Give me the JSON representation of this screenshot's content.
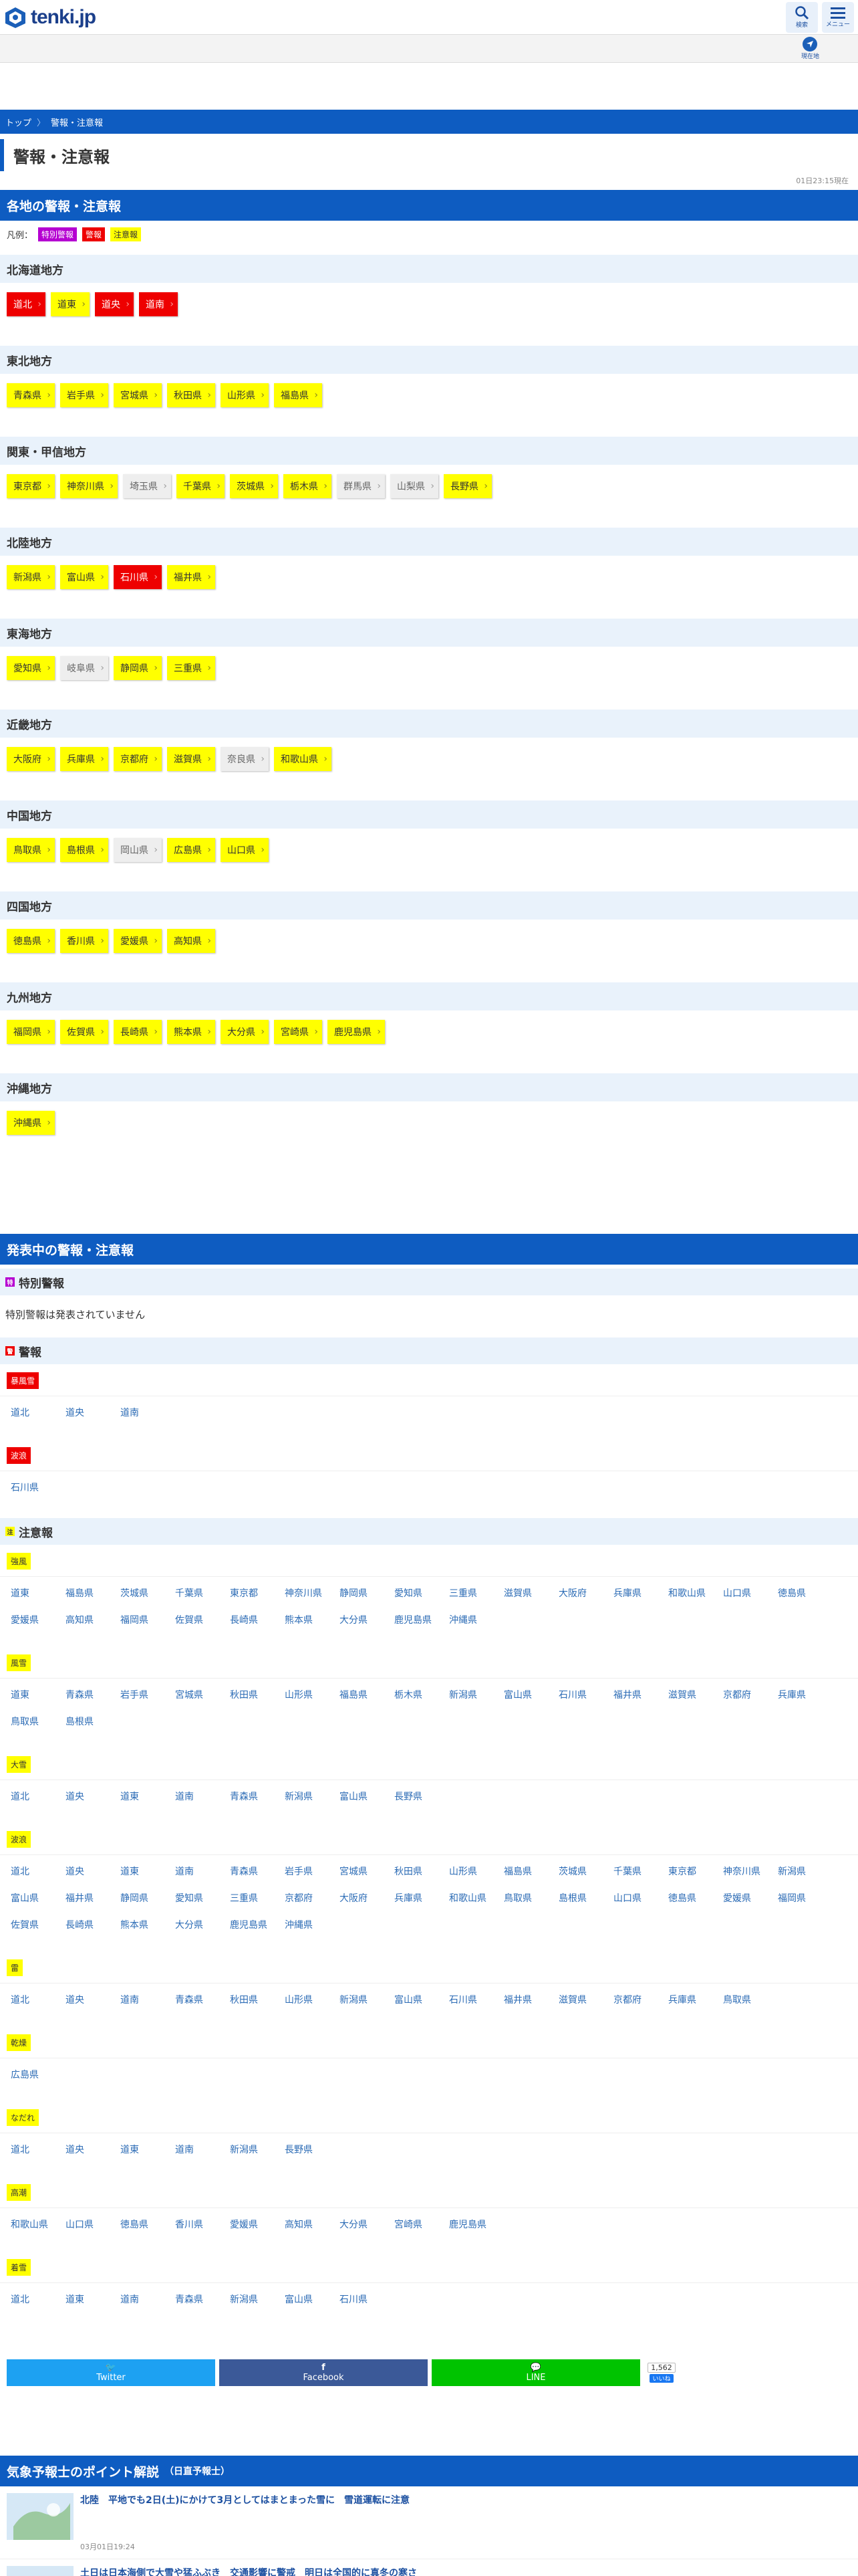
{
  "header": {
    "logo_text": "tenki.jp",
    "btn_search": "検索",
    "btn_menu": "メニュー",
    "btn_location": "現在地"
  },
  "breadcrumb": {
    "home": "トップ",
    "current": "警報・注意報"
  },
  "page_title": "警報・注意報",
  "updated": "01日23:15現在",
  "regions_heading": "各地の警報・注意報",
  "legend": {
    "label": "凡例：",
    "special": "特別警報",
    "warning": "警報",
    "advisory": "注意報"
  },
  "regions": [
    {
      "name": "北海道地方",
      "items": [
        {
          "n": "道北",
          "s": "red"
        },
        {
          "n": "道東",
          "s": "yel"
        },
        {
          "n": "道央",
          "s": "red"
        },
        {
          "n": "道南",
          "s": "red"
        }
      ]
    },
    {
      "name": "東北地方",
      "items": [
        {
          "n": "青森県",
          "s": "yel"
        },
        {
          "n": "岩手県",
          "s": "yel"
        },
        {
          "n": "宮城県",
          "s": "yel"
        },
        {
          "n": "秋田県",
          "s": "yel"
        },
        {
          "n": "山形県",
          "s": "yel"
        },
        {
          "n": "福島県",
          "s": "yel"
        }
      ]
    },
    {
      "name": "関東・甲信地方",
      "items": [
        {
          "n": "東京都",
          "s": "yel"
        },
        {
          "n": "神奈川県",
          "s": "yel"
        },
        {
          "n": "埼玉県",
          "s": "gry"
        },
        {
          "n": "千葉県",
          "s": "yel"
        },
        {
          "n": "茨城県",
          "s": "yel"
        },
        {
          "n": "栃木県",
          "s": "yel"
        },
        {
          "n": "群馬県",
          "s": "gry"
        },
        {
          "n": "山梨県",
          "s": "gry"
        },
        {
          "n": "長野県",
          "s": "yel"
        }
      ]
    },
    {
      "name": "北陸地方",
      "items": [
        {
          "n": "新潟県",
          "s": "yel"
        },
        {
          "n": "富山県",
          "s": "yel"
        },
        {
          "n": "石川県",
          "s": "red"
        },
        {
          "n": "福井県",
          "s": "yel"
        }
      ]
    },
    {
      "name": "東海地方",
      "items": [
        {
          "n": "愛知県",
          "s": "yel"
        },
        {
          "n": "岐阜県",
          "s": "gry"
        },
        {
          "n": "静岡県",
          "s": "yel"
        },
        {
          "n": "三重県",
          "s": "yel"
        }
      ]
    },
    {
      "name": "近畿地方",
      "items": [
        {
          "n": "大阪府",
          "s": "yel"
        },
        {
          "n": "兵庫県",
          "s": "yel"
        },
        {
          "n": "京都府",
          "s": "yel"
        },
        {
          "n": "滋賀県",
          "s": "yel"
        },
        {
          "n": "奈良県",
          "s": "gry"
        },
        {
          "n": "和歌山県",
          "s": "yel"
        }
      ]
    },
    {
      "name": "中国地方",
      "items": [
        {
          "n": "鳥取県",
          "s": "yel"
        },
        {
          "n": "島根県",
          "s": "yel"
        },
        {
          "n": "岡山県",
          "s": "gry"
        },
        {
          "n": "広島県",
          "s": "yel"
        },
        {
          "n": "山口県",
          "s": "yel"
        }
      ]
    },
    {
      "name": "四国地方",
      "items": [
        {
          "n": "徳島県",
          "s": "yel"
        },
        {
          "n": "香川県",
          "s": "yel"
        },
        {
          "n": "愛媛県",
          "s": "yel"
        },
        {
          "n": "高知県",
          "s": "yel"
        }
      ]
    },
    {
      "name": "九州地方",
      "items": [
        {
          "n": "福岡県",
          "s": "yel"
        },
        {
          "n": "佐賀県",
          "s": "yel"
        },
        {
          "n": "長崎県",
          "s": "yel"
        },
        {
          "n": "熊本県",
          "s": "yel"
        },
        {
          "n": "大分県",
          "s": "yel"
        },
        {
          "n": "宮崎県",
          "s": "yel"
        },
        {
          "n": "鹿児島県",
          "s": "yel"
        }
      ]
    },
    {
      "name": "沖縄地方",
      "items": [
        {
          "n": "沖縄県",
          "s": "yel"
        }
      ]
    }
  ],
  "announce_heading": "発表中の警報・注意報",
  "special": {
    "title": "特別警報",
    "icon": "特",
    "note": "特別警報は発表されていません"
  },
  "warnings": {
    "title": "警報",
    "icon": "警",
    "types": [
      {
        "label": "暴風雪",
        "areas": [
          "道北",
          "道央",
          "道南"
        ]
      },
      {
        "label": "波浪",
        "areas": [
          "石川県"
        ]
      }
    ]
  },
  "advisories": {
    "title": "注意報",
    "icon": "注",
    "types": [
      {
        "label": "強風",
        "areas": [
          "道東",
          "福島県",
          "茨城県",
          "千葉県",
          "東京都",
          "神奈川県",
          "静岡県",
          "愛知県",
          "三重県",
          "滋賀県",
          "大阪府",
          "兵庫県",
          "和歌山県",
          "山口県",
          "徳島県",
          "愛媛県",
          "高知県",
          "福岡県",
          "佐賀県",
          "長崎県",
          "熊本県",
          "大分県",
          "鹿児島県",
          "沖縄県"
        ]
      },
      {
        "label": "風雪",
        "areas": [
          "道東",
          "青森県",
          "岩手県",
          "宮城県",
          "秋田県",
          "山形県",
          "福島県",
          "栃木県",
          "新潟県",
          "富山県",
          "石川県",
          "福井県",
          "滋賀県",
          "京都府",
          "兵庫県",
          "鳥取県",
          "島根県"
        ]
      },
      {
        "label": "大雪",
        "areas": [
          "道北",
          "道央",
          "道東",
          "道南",
          "青森県",
          "新潟県",
          "富山県",
          "長野県"
        ]
      },
      {
        "label": "波浪",
        "areas": [
          "道北",
          "道央",
          "道東",
          "道南",
          "青森県",
          "岩手県",
          "宮城県",
          "秋田県",
          "山形県",
          "福島県",
          "茨城県",
          "千葉県",
          "東京都",
          "神奈川県",
          "新潟県",
          "富山県",
          "福井県",
          "静岡県",
          "愛知県",
          "三重県",
          "京都府",
          "大阪府",
          "兵庫県",
          "和歌山県",
          "鳥取県",
          "島根県",
          "山口県",
          "徳島県",
          "愛媛県",
          "福岡県",
          "佐賀県",
          "長崎県",
          "熊本県",
          "大分県",
          "鹿児島県",
          "沖縄県"
        ]
      },
      {
        "label": "雷",
        "areas": [
          "道北",
          "道央",
          "道南",
          "青森県",
          "秋田県",
          "山形県",
          "新潟県",
          "富山県",
          "石川県",
          "福井県",
          "滋賀県",
          "京都府",
          "兵庫県",
          "鳥取県"
        ]
      },
      {
        "label": "乾燥",
        "areas": [
          "広島県"
        ]
      },
      {
        "label": "なだれ",
        "areas": [
          "道北",
          "道央",
          "道東",
          "道南",
          "新潟県",
          "長野県"
        ]
      },
      {
        "label": "高潮",
        "areas": [
          "和歌山県",
          "山口県",
          "徳島県",
          "香川県",
          "愛媛県",
          "高知県",
          "大分県",
          "宮崎県",
          "鹿児島県"
        ]
      },
      {
        "label": "着雪",
        "areas": [
          "道北",
          "道東",
          "道南",
          "青森県",
          "新潟県",
          "富山県",
          "石川県"
        ]
      }
    ]
  },
  "share": {
    "twitter": "Twitter",
    "facebook": "Facebook",
    "line": "LINE",
    "count": "1,562",
    "like": "いいね"
  },
  "kisho": {
    "heading": "気象予報士のポイント解説",
    "sub": "（日直予報士）",
    "articles": [
      {
        "title": "北陸　平地でも2日(土)にかけて3月としてはまとまった雪に　雪道運転に注意",
        "time": "03月01日19:24"
      },
      {
        "title": "土日は日本海側で大雪や猛ふぶき　交通影響に警戒　明日は全国的に真冬の寒さ",
        "time": ""
      }
    ]
  },
  "colors": {
    "brand": "#0e5cc1",
    "special": "#b500d1",
    "warning": "#ee0000",
    "advisory": "#ffff00"
  }
}
